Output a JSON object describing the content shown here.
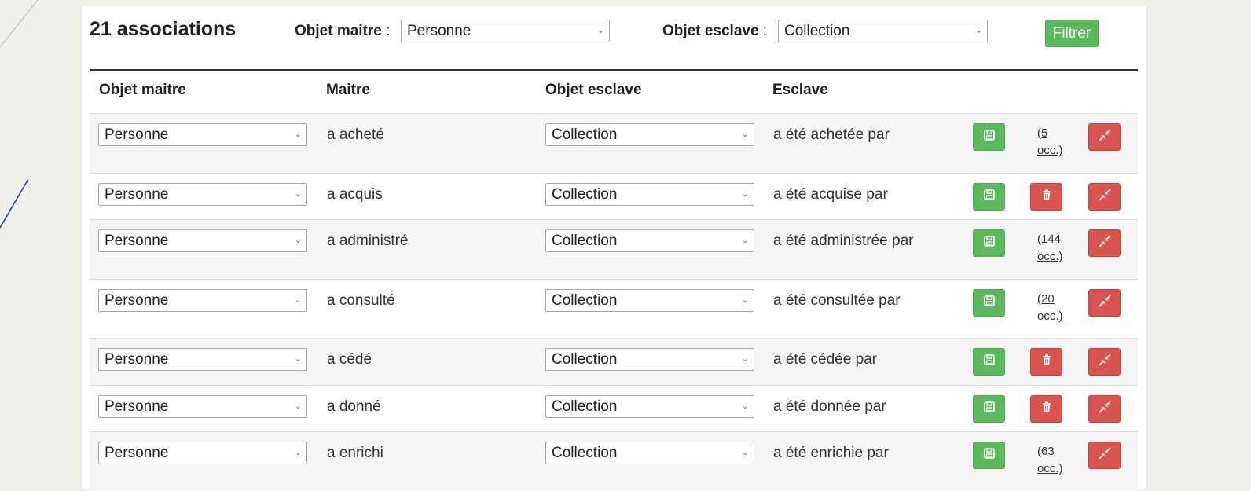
{
  "header": {
    "count": "21 associations",
    "master_label": "Objet maitre",
    "master_value": "Personne",
    "slave_label": "Objet esclave",
    "slave_value": "Collection",
    "filter_button": "Filtrer",
    "separator": " :"
  },
  "columns": [
    "Objet maitre",
    "Maitre",
    "Objet esclave",
    "Esclave"
  ],
  "rows": [
    {
      "master_obj": "Personne",
      "master": "a acheté",
      "slave_obj": "Collection",
      "slave": "a été achetée par",
      "occ_line1": "(5",
      "occ_line2": "occ.)",
      "has_delete": false
    },
    {
      "master_obj": "Personne",
      "master": "a acquis",
      "slave_obj": "Collection",
      "slave": "a été acquise par",
      "occ_line1": "",
      "occ_line2": "",
      "has_delete": true
    },
    {
      "master_obj": "Personne",
      "master": "a administré",
      "slave_obj": "Collection",
      "slave": "a été administrée par",
      "occ_line1": "(144",
      "occ_line2": "occ.)",
      "has_delete": false
    },
    {
      "master_obj": "Personne",
      "master": "a consulté",
      "slave_obj": "Collection",
      "slave": "a été consultée par",
      "occ_line1": "(20",
      "occ_line2": "occ.)",
      "has_delete": false
    },
    {
      "master_obj": "Personne",
      "master": "a cédé",
      "slave_obj": "Collection",
      "slave": "a été cédée par",
      "occ_line1": "",
      "occ_line2": "",
      "has_delete": true
    },
    {
      "master_obj": "Personne",
      "master": "a donné",
      "slave_obj": "Collection",
      "slave": "a été donnée par",
      "occ_line1": "",
      "occ_line2": "",
      "has_delete": true
    },
    {
      "master_obj": "Personne",
      "master": "a enrichi",
      "slave_obj": "Collection",
      "slave": "a été enrichie par",
      "occ_line1": "(63",
      "occ_line2": "occ.)",
      "has_delete": false
    }
  ],
  "icons": {
    "save": "floppy-disk-icon",
    "delete": "trash-icon",
    "unlink": "compress-arrows-icon",
    "dropdown": "chevron-down-icon"
  },
  "colors": {
    "success": "#5cb85c",
    "danger": "#d9534f"
  }
}
